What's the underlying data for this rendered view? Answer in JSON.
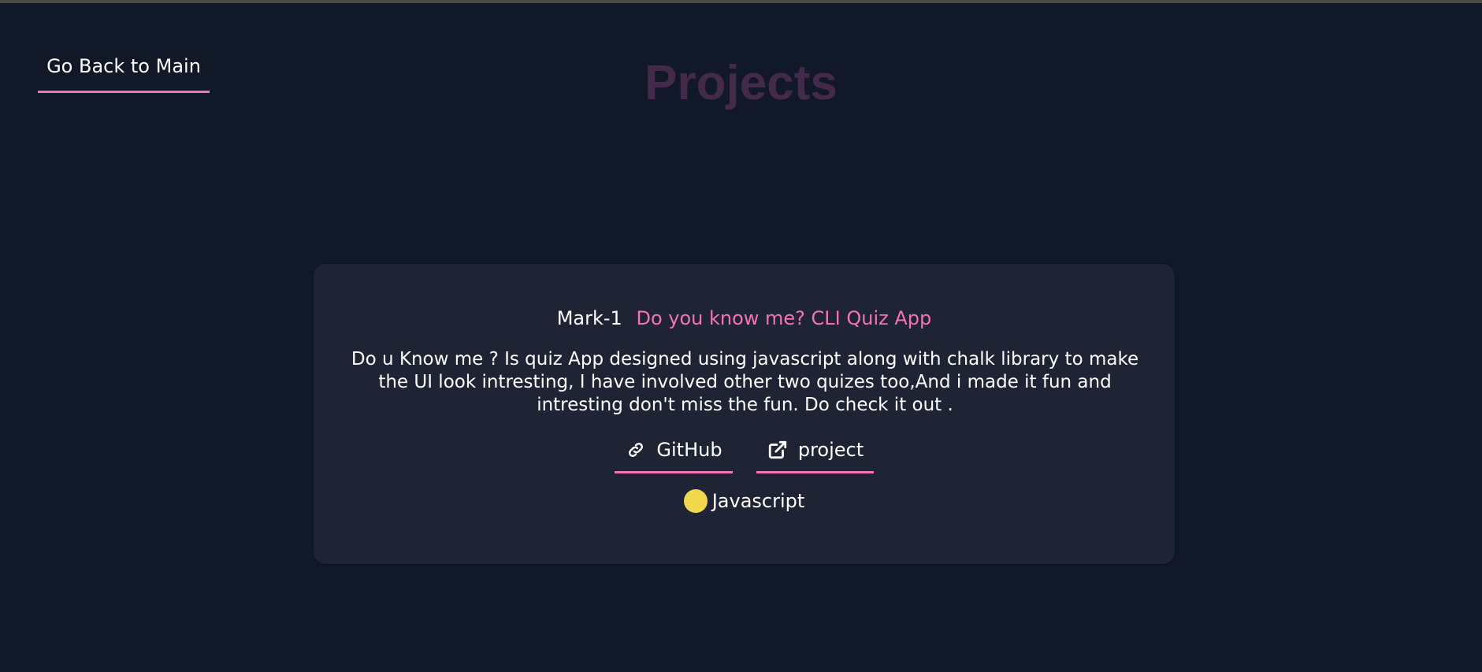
{
  "nav": {
    "back_label": "Go Back to Main"
  },
  "page": {
    "title": "Projects"
  },
  "project": {
    "mark": "Mark-1",
    "name": "Do you know me? CLI Quiz App",
    "description": "Do u Know me ? Is quiz App designed using javascript along with chalk library to make the UI look intresting, I have involved other two quizes too,And i made it fun and intresting don't miss the fun. Do check it out .",
    "links": {
      "github_label": "GitHub",
      "github_icon": "link-icon",
      "project_label": "project",
      "project_icon": "external-link-icon"
    },
    "tech": {
      "label": "Javascript",
      "color": "#f0d84a"
    }
  },
  "colors": {
    "background": "#111827",
    "card": "#1f2435",
    "accent": "#f472b6",
    "title": "#432a4b"
  }
}
